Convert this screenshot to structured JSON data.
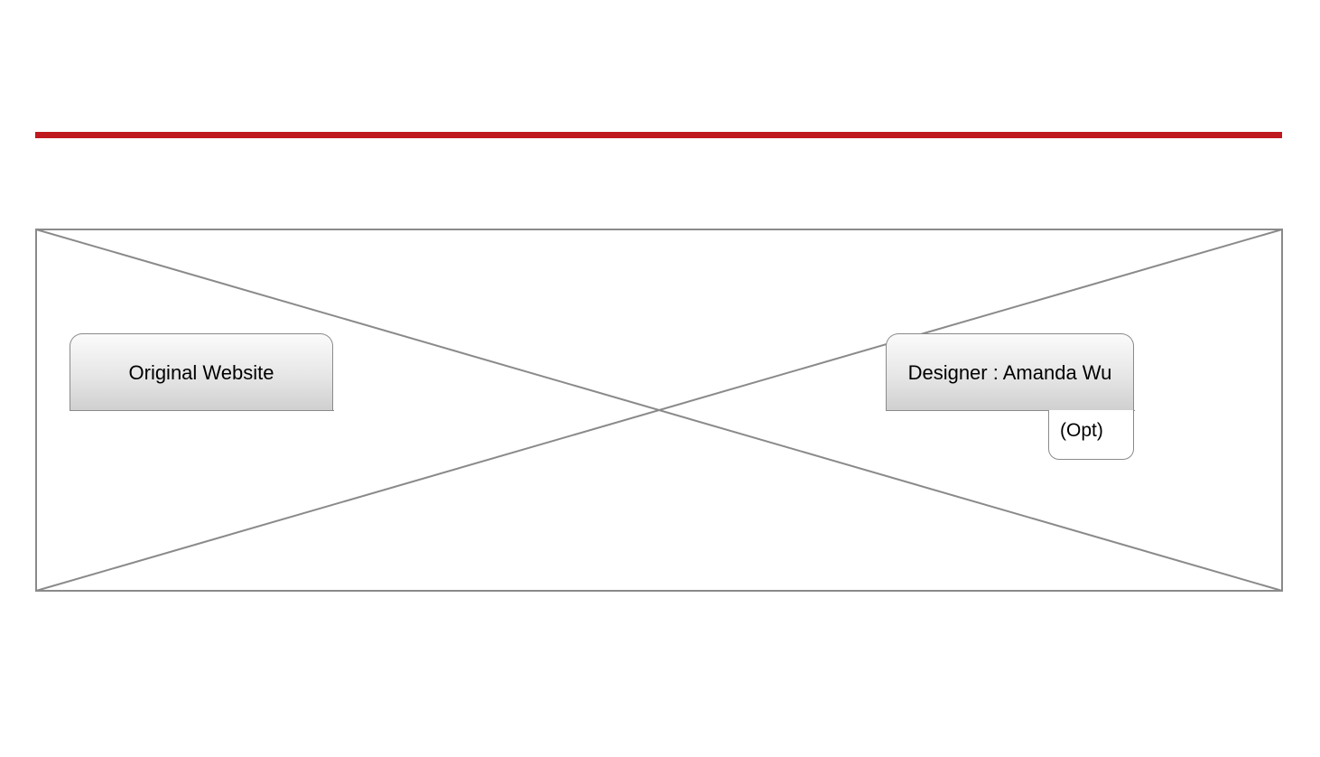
{
  "header": {
    "accent_rule_color": "#c0181f"
  },
  "hero": {
    "image_placeholder": "image-placeholder",
    "frame_color": "#8a8a8a"
  },
  "nav": {
    "original_website_label": "Original Website",
    "designer_label": "Designer : Amanda Wu",
    "opt_label": "(Opt)"
  }
}
